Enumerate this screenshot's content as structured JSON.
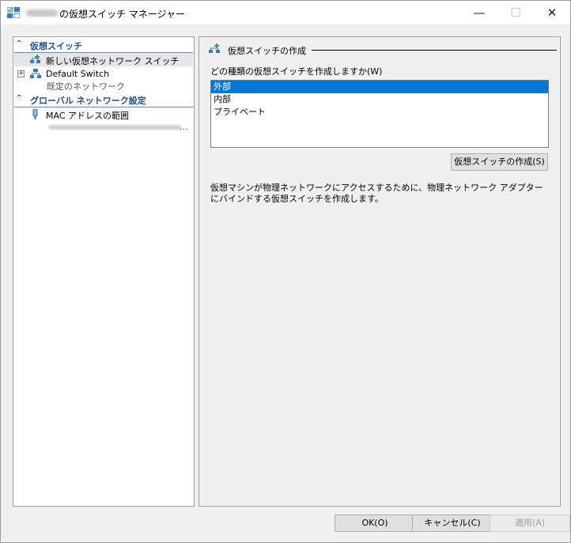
{
  "window": {
    "title": "の仮想スイッチ マネージャー",
    "controls": {
      "minimize": "—",
      "maximize": "☐",
      "close": "✕"
    }
  },
  "sidebar": {
    "sections": [
      {
        "label": "仮想スイッチ",
        "items": [
          {
            "label": "新しい仮想ネットワーク スイッチ",
            "selected": true,
            "icon": "new-switch-icon"
          },
          {
            "label": "Default Switch",
            "sublabel": "既定のネットワーク",
            "icon": "network-switch-icon",
            "expander": "+"
          }
        ]
      },
      {
        "label": "グローバル ネットワーク設定",
        "items": [
          {
            "label": "MAC アドレスの範囲",
            "sublabel": "...",
            "icon": "mac-range-icon"
          }
        ]
      }
    ],
    "collapse_glyph": "⌃"
  },
  "main": {
    "section_title": "仮想スイッチの作成",
    "question": "どの種類の仮想スイッチを作成しますか(W)",
    "switch_types": [
      "外部",
      "内部",
      "プライベート"
    ],
    "selected_type": "外部",
    "create_button": "仮想スイッチの作成(S)",
    "description": "仮想マシンが物理ネットワークにアクセスするために、物理ネットワーク アダプターにバインドする仮想スイッチを作成します。"
  },
  "footer": {
    "ok": "OK(O)",
    "cancel": "キャンセル(C)",
    "apply": "適用(A)"
  },
  "colors": {
    "accent": "#0078d7",
    "section_header": "#1e4e8c",
    "icon_green": "#3aa637",
    "icon_blue": "#3a78c2"
  }
}
